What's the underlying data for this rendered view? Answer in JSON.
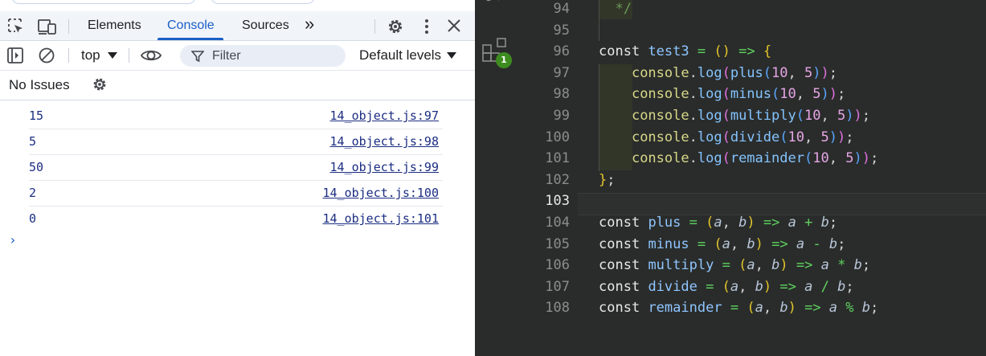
{
  "devtools": {
    "tabs": [
      {
        "label": "Elements",
        "active": false
      },
      {
        "label": "Console",
        "active": true
      },
      {
        "label": "Sources",
        "active": false
      }
    ],
    "more_tabs_glyph": "»",
    "context_select": "top",
    "filter_placeholder": "Filter",
    "levels_select": "Default levels",
    "issues_label": "No Issues",
    "accent_color": "#1a5fc7",
    "logs": [
      {
        "value": "15",
        "source": "14_object.js:97"
      },
      {
        "value": "5",
        "source": "14_object.js:98"
      },
      {
        "value": "50",
        "source": "14_object.js:99"
      },
      {
        "value": "2",
        "source": "14_object.js:100"
      },
      {
        "value": "0",
        "source": "14_object.js:101"
      }
    ],
    "prompt_glyph": "›"
  },
  "editor": {
    "activity_badge": "1",
    "current_line": 103,
    "lines": [
      {
        "n": 94
      },
      {
        "n": 95
      },
      {
        "n": 96
      },
      {
        "n": 97
      },
      {
        "n": 98
      },
      {
        "n": 99
      },
      {
        "n": 100
      },
      {
        "n": 101
      },
      {
        "n": 102
      },
      {
        "n": 103
      },
      {
        "n": 104
      },
      {
        "n": 105
      },
      {
        "n": 106
      },
      {
        "n": 107
      },
      {
        "n": 108
      }
    ]
  }
}
